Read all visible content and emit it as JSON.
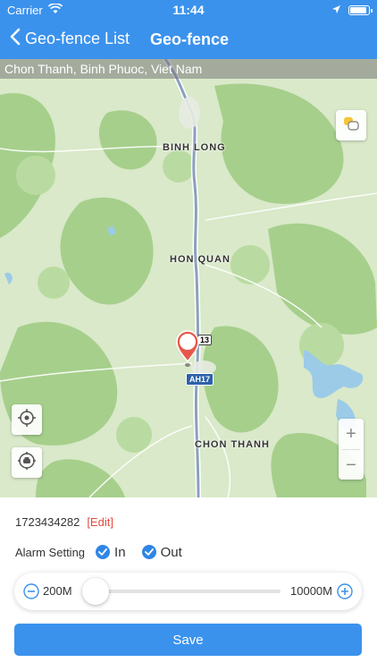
{
  "status_bar": {
    "carrier": "Carrier",
    "time": "11:44",
    "battery_level": 0.95
  },
  "nav": {
    "back_label": "Geo-fence List",
    "title": "Geo-fence"
  },
  "map": {
    "address": "Chon Thanh, Binh Phuoc, Viet Nam",
    "places": {
      "binh_long": "BINH LONG",
      "hon_quan": "HON QUAN",
      "chon_thanh": "CHON THANH"
    },
    "road_shield": "AH17",
    "road_number": "13",
    "zoom_in": "+",
    "zoom_out": "−"
  },
  "panel": {
    "device_id": "1723434282",
    "edit_label": "[Edit]",
    "alarm_label": "Alarm Setting",
    "alarm_in_label": "In",
    "alarm_out_label": "Out",
    "alarm_in_checked": true,
    "alarm_out_checked": true,
    "radius_min": "200M",
    "radius_max": "10000M",
    "radius_value_fraction": 0.0,
    "save_label": "Save"
  },
  "colors": {
    "accent": "#3b92ec",
    "edit": "#e34b3f",
    "checkbox": "#2f86e6",
    "pin": "#e8584a"
  }
}
